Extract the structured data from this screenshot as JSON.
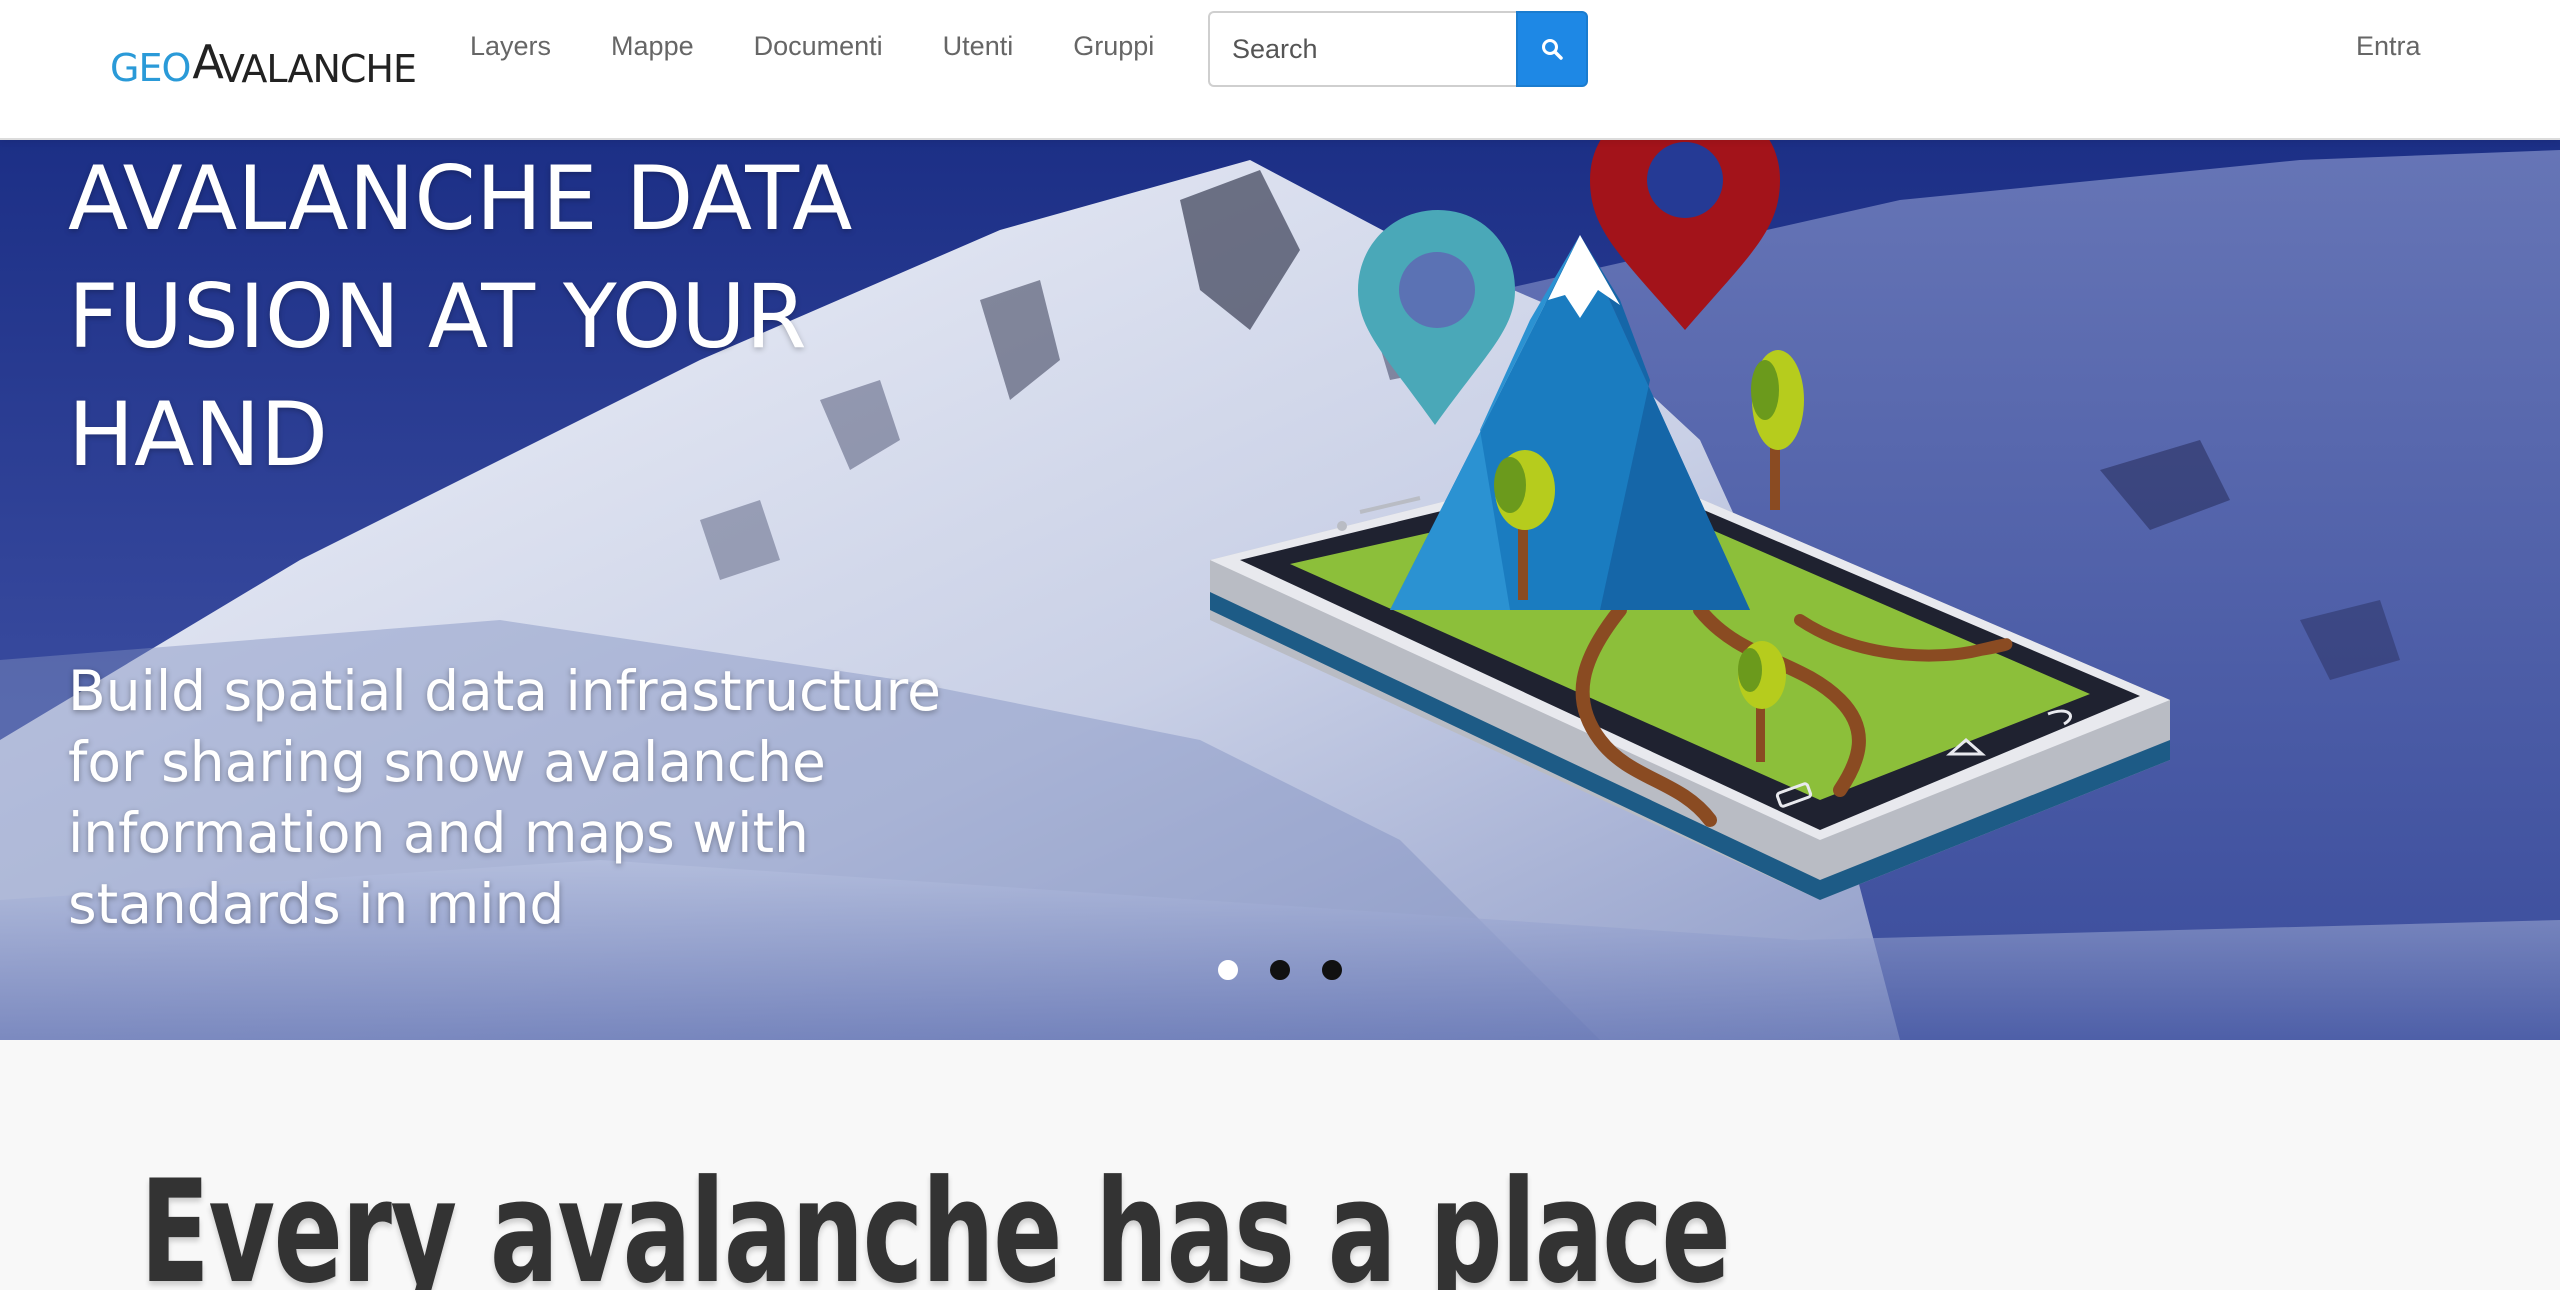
{
  "navbar": {
    "brand": {
      "geo": "GEO",
      "a": "A",
      "rest": "VALANCHE"
    },
    "links": [
      {
        "label": "Layers"
      },
      {
        "label": "Mappe"
      },
      {
        "label": "Documenti"
      },
      {
        "label": "Utenti"
      },
      {
        "label": "Gruppi"
      }
    ],
    "search": {
      "placeholder": "Search",
      "icon": "search-icon"
    },
    "login_label": "Entra"
  },
  "hero": {
    "title": "AVALANCHE DATA FUSION AT YOUR HAND",
    "subtitle": "Build spatial data infrastructure for sharing snow avalanche information and maps with standards in mind",
    "slide_count": 3,
    "active_slide": 1
  },
  "lower": {
    "tagline": "Every avalanche has a place"
  },
  "colors": {
    "brand_blue": "#2a9ad8",
    "search_button": "#1e88e5",
    "nav_text": "#666666",
    "hero_sky": "#2b3d8a",
    "pin_teal": "#4aa8b8",
    "pin_red": "#a3131a",
    "mountain_blue": "#1a7cc0",
    "map_green": "#8cbf3a"
  }
}
